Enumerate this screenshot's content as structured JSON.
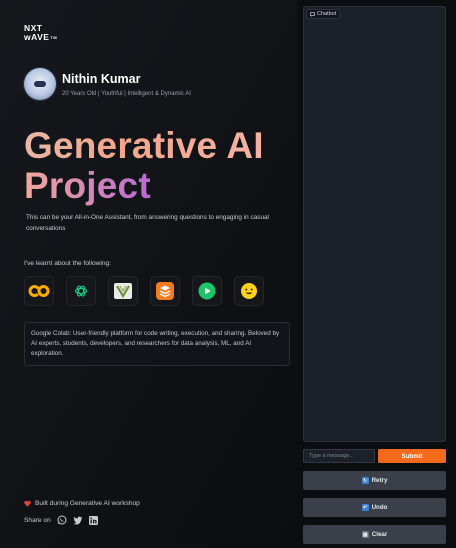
{
  "brand": {
    "line1": "NXT",
    "line2": "wAVE",
    "tm": "TM"
  },
  "profile": {
    "name": "Nithin Kumar",
    "tagline": "20 Years Old | Youthful | Intelligent & Dynamic AI"
  },
  "hero": {
    "title_line1": "Generative AI",
    "title_line2": "Project",
    "description": "This can be your All-in-One Assistant, from answering questions to engaging in casual conversations"
  },
  "learnt": {
    "heading": "I've learnt about the following:",
    "tools": [
      {
        "icon": "google-colab-icon"
      },
      {
        "icon": "chatgpt-icon"
      },
      {
        "icon": "vertex-ai-icon"
      },
      {
        "icon": "gemini-stack-icon"
      },
      {
        "icon": "play-icon"
      },
      {
        "icon": "hugging-face-icon"
      }
    ],
    "info": "Google Colab: User-friendly platform for code writing, execution, and sharing. Beloved by AI experts, students, developers, and researchers for data analysis, ML, and AI exploration."
  },
  "footer": {
    "built": "Built during Generative AI workshop",
    "share": "Share on"
  },
  "chat": {
    "label": "Chatbot",
    "placeholder": "Type a message...",
    "submit": "Submit",
    "retry": "Retry",
    "undo": "Undo",
    "clear": "Clear"
  },
  "colors": {
    "accent": "#f26a1c",
    "heart": "#e0443b",
    "panel": "#1c2129"
  }
}
